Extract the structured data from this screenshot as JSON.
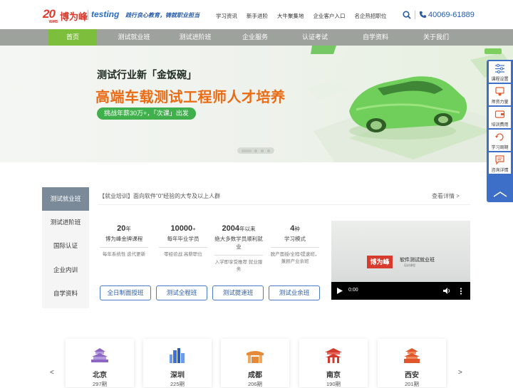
{
  "header": {
    "logo_num": "20",
    "logo_sub": "YEARS",
    "brand": "博为峰",
    "brand2": "testing",
    "slogan": "践行良心教育，铸就职业担当",
    "links": [
      "学习资讯",
      "新手进阶",
      "大牛聚集地",
      "企业客户入口",
      "名企热招职位"
    ],
    "phone": "40069-61889",
    "icons": [
      "search-icon",
      "phone-icon"
    ]
  },
  "nav": {
    "items": [
      "首页",
      "测试就业班",
      "测试进阶班",
      "企业服务",
      "认证考试",
      "自学资料",
      "关于我们"
    ],
    "active_index": 0,
    "accent": "#7dbf3c"
  },
  "banner": {
    "line1": "测试行业新「金饭碗」",
    "line2": "高端车载测试工程师人才培养",
    "pill": "挑战年薪30万+，「次课」出发",
    "slides": 4,
    "active_slide": 0
  },
  "sidebar": {
    "items": [
      {
        "label": "课程设置",
        "icon": "sliders-icon"
      },
      {
        "label": "师资力量",
        "icon": "teacher-icon"
      },
      {
        "label": "培训费用",
        "icon": "wallet-icon"
      },
      {
        "label": "学习周期",
        "icon": "cycle-icon"
      },
      {
        "label": "咨询详情",
        "icon": "chat-icon"
      }
    ],
    "up_icon": "chevron-up-icon",
    "color": "#3d6fc8"
  },
  "courses": {
    "tabs": [
      "测试就业班",
      "测试进阶班",
      "国际认证",
      "企业内训",
      "自学资料"
    ],
    "active_tab": 0,
    "title": "【就业培训】面向软件\"0\"经验的大专及以上人群",
    "more": "查看详情 >",
    "stats": [
      {
        "num": "20",
        "unit": "年",
        "label": "博为峰金牌课程",
        "sub": "每年系统性 迭代更新"
      },
      {
        "num": "10000",
        "unit": "+",
        "label": "每年毕业学员",
        "sub": "零经验战 高薪职位"
      },
      {
        "num": "2004",
        "unit": "年以来",
        "label": "绝大多数学员顺利就业",
        "sub": "入学即享受推荐 就业服务"
      },
      {
        "num": "4",
        "unit": "种",
        "label": "学习模式",
        "sub": "脱产面授/全程/提速班，兼顾产业余班"
      }
    ],
    "buttons": [
      "全日制面授班",
      "测试全程班",
      "测试提速班",
      "测试业余班"
    ],
    "video": {
      "badge": "博为峰",
      "title": "软件测试就业班",
      "subtitle": "培训课程",
      "time": "0:00"
    }
  },
  "cities": {
    "items": [
      {
        "name": "北京",
        "count": "297期",
        "color": "#8e67c4",
        "icon": "temple-icon"
      },
      {
        "name": "深圳",
        "count": "225期",
        "color": "#3b73d6",
        "icon": "skyline-icon"
      },
      {
        "name": "成都",
        "count": "206期",
        "color": "#e58a3a",
        "icon": "gate-icon"
      },
      {
        "name": "南京",
        "count": "190期",
        "color": "#d23a2e",
        "icon": "pavilion-icon"
      },
      {
        "name": "西安",
        "count": "201期",
        "color": "#e0572d",
        "icon": "tower-icon"
      }
    ],
    "prev": "<",
    "next": ">"
  }
}
